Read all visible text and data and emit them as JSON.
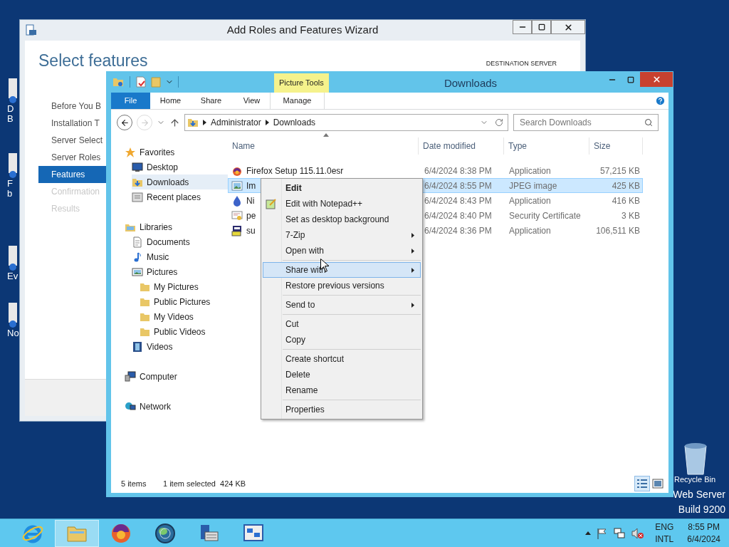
{
  "desktop": {
    "icons": [
      {
        "label_lines": [
          "D",
          "B"
        ]
      },
      {
        "label_lines": [
          "F",
          "b"
        ]
      },
      {
        "label_lines": [
          "Ev"
        ]
      },
      {
        "label_lines": [
          "No"
        ]
      }
    ],
    "recycle_bin": {
      "label": "Recycle Bin"
    },
    "edition_lines": [
      "Web Server",
      "Build 9200"
    ]
  },
  "wizard": {
    "title": "Add Roles and Features Wizard",
    "heading": "Select features",
    "destination_label": "DESTINATION SERVER",
    "steps": [
      {
        "label": "Before You B",
        "selected": false,
        "disabled": false
      },
      {
        "label": "Installation T",
        "selected": false,
        "disabled": false
      },
      {
        "label": "Server Select",
        "selected": false,
        "disabled": false
      },
      {
        "label": "Server Roles",
        "selected": false,
        "disabled": false
      },
      {
        "label": "Features",
        "selected": true,
        "disabled": false
      },
      {
        "label": "Confirmation",
        "selected": false,
        "disabled": true
      },
      {
        "label": "Results",
        "selected": false,
        "disabled": true
      }
    ]
  },
  "explorer": {
    "title": "Downloads",
    "contextual_tab": "Picture Tools",
    "tabs": [
      {
        "label": "File",
        "kind": "file"
      },
      {
        "label": "Home",
        "kind": "tab"
      },
      {
        "label": "Share",
        "kind": "tab"
      },
      {
        "label": "View",
        "kind": "tab"
      },
      {
        "label": "Manage",
        "kind": "contextual"
      }
    ],
    "breadcrumb": [
      "Administrator",
      "Downloads"
    ],
    "search": {
      "placeholder": "Search Downloads"
    },
    "nav": [
      {
        "label": "Favorites",
        "kind": "star",
        "selected": false,
        "children": [
          {
            "label": "Desktop",
            "kind": "desktop",
            "selected": false
          },
          {
            "label": "Downloads",
            "kind": "downloads",
            "selected": true
          },
          {
            "label": "Recent places",
            "kind": "recent",
            "selected": false
          }
        ]
      },
      {
        "label": "Libraries",
        "kind": "libraries",
        "selected": false,
        "children": [
          {
            "label": "Documents",
            "kind": "document",
            "selected": false
          },
          {
            "label": "Music",
            "kind": "music",
            "selected": false
          },
          {
            "label": "Pictures",
            "kind": "pictures",
            "selected": false,
            "children": [
              {
                "label": "My Pictures",
                "kind": "folder",
                "selected": false
              },
              {
                "label": "Public Pictures",
                "kind": "folder",
                "selected": false
              },
              {
                "label": "My Videos",
                "kind": "folder",
                "selected": false
              },
              {
                "label": "Public Videos",
                "kind": "folder",
                "selected": false
              }
            ]
          },
          {
            "label": "Videos",
            "kind": "video",
            "selected": false
          }
        ]
      },
      {
        "label": "Computer",
        "kind": "computer",
        "selected": false
      },
      {
        "label": "Network",
        "kind": "network",
        "selected": false
      }
    ],
    "columns": [
      "Name",
      "Date modified",
      "Type",
      "Size"
    ],
    "rows": [
      {
        "kind": "firefox",
        "name": "Firefox Setup 115.11.0esr",
        "date": "6/4/2024 8:38 PM",
        "type": "Application",
        "size": "57,215 KB",
        "selected": false
      },
      {
        "kind": "image",
        "name": "Im",
        "date": "6/4/2024 8:55 PM",
        "type": "JPEG image",
        "size": "425 KB",
        "selected": true
      },
      {
        "kind": "drop",
        "name": "Ni",
        "date": "6/4/2024 8:43 PM",
        "type": "Application",
        "size": "416 KB",
        "selected": false
      },
      {
        "kind": "certificate",
        "name": "pe",
        "date": "6/4/2024 8:40 PM",
        "type": "Security Certificate",
        "size": "3 KB",
        "selected": false
      },
      {
        "kind": "installer",
        "name": "su",
        "date": "6/4/2024 8:36 PM",
        "type": "Application",
        "size": "106,511 KB",
        "selected": false
      }
    ],
    "status": {
      "count": "5 items",
      "selection": "1 item selected  424 KB"
    },
    "views": [
      {
        "kind": "details",
        "selected": true
      },
      {
        "kind": "thumbnails",
        "selected": false
      }
    ]
  },
  "context_menu": {
    "items": [
      {
        "kind": "item",
        "label": "Edit",
        "default": true,
        "submenu": false,
        "highlighted": false
      },
      {
        "kind": "icon-item",
        "label": "Edit with Notepad++",
        "default": false,
        "submenu": false,
        "highlighted": false
      },
      {
        "kind": "item",
        "label": "Set as desktop background",
        "default": false,
        "submenu": false,
        "highlighted": false
      },
      {
        "kind": "item",
        "label": "7-Zip",
        "default": false,
        "submenu": true,
        "highlighted": false
      },
      {
        "kind": "item",
        "label": "Open with",
        "default": false,
        "submenu": true,
        "highlighted": false
      },
      {
        "kind": "separator"
      },
      {
        "kind": "item",
        "label": "Share with",
        "default": false,
        "submenu": true,
        "highlighted": true
      },
      {
        "kind": "item",
        "label": "Restore previous versions",
        "default": false,
        "submenu": false,
        "highlighted": false
      },
      {
        "kind": "separator"
      },
      {
        "kind": "item",
        "label": "Send to",
        "default": false,
        "submenu": true,
        "highlighted": false
      },
      {
        "kind": "separator"
      },
      {
        "kind": "item",
        "label": "Cut",
        "default": false,
        "submenu": false,
        "highlighted": false
      },
      {
        "kind": "item",
        "label": "Copy",
        "default": false,
        "submenu": false,
        "highlighted": false
      },
      {
        "kind": "separator"
      },
      {
        "kind": "item",
        "label": "Create shortcut",
        "default": false,
        "submenu": false,
        "highlighted": false
      },
      {
        "kind": "item",
        "label": "Delete",
        "default": false,
        "submenu": false,
        "highlighted": false
      },
      {
        "kind": "item",
        "label": "Rename",
        "default": false,
        "submenu": false,
        "highlighted": false
      },
      {
        "kind": "separator"
      },
      {
        "kind": "item",
        "label": "Properties",
        "default": false,
        "submenu": false,
        "highlighted": false
      }
    ]
  },
  "taskbar": {
    "apps": [
      {
        "kind": "ie",
        "active": false
      },
      {
        "kind": "explorer",
        "active": true
      },
      {
        "kind": "firefox",
        "active": false
      },
      {
        "kind": "globe",
        "active": false
      },
      {
        "kind": "server",
        "active": false
      },
      {
        "kind": "network-app",
        "active": false
      }
    ],
    "language": [
      "ENG",
      "INTL"
    ],
    "time": "8:55 PM",
    "date": "6/4/2024"
  }
}
